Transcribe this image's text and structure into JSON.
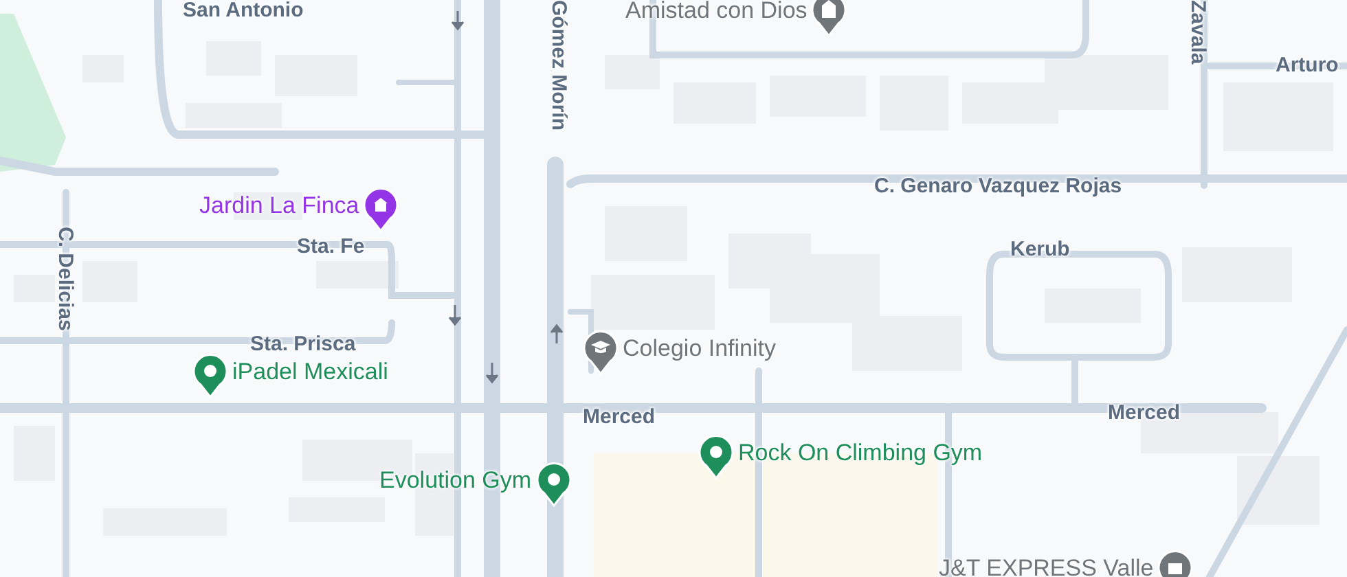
{
  "streets": [
    {
      "name": "San Antonio",
      "kind": "horizontal"
    },
    {
      "name": "Gómez Morín",
      "kind": "vertical"
    },
    {
      "name": "C. Genaro Vazquez Rojas",
      "kind": "horizontal"
    },
    {
      "name": "Sta. Fe",
      "kind": "horizontal"
    },
    {
      "name": "C. Delicias",
      "kind": "vertical"
    },
    {
      "name": "Kerub",
      "kind": "horizontal"
    },
    {
      "name": "Sta. Prisca",
      "kind": "horizontal"
    },
    {
      "name": "Merced",
      "kind": "horizontal"
    },
    {
      "name": "Merced",
      "kind": "horizontal"
    },
    {
      "name": "Zavala",
      "kind": "vertical"
    },
    {
      "name": "Arturo",
      "kind": "horizontal"
    }
  ],
  "places": [
    {
      "name": "Amistad con Dios",
      "kind": "worship",
      "color": "#70757a"
    },
    {
      "name": "Jardin La Finca",
      "kind": "garden",
      "color": "#9334e6"
    },
    {
      "name": "Colegio Infinity",
      "kind": "school",
      "color": "#70757a"
    },
    {
      "name": "iPadel Mexicali",
      "kind": "generic",
      "color": "#1e8e5a"
    },
    {
      "name": "Evolution Gym",
      "kind": "generic",
      "color": "#1e8e5a"
    },
    {
      "name": "Rock On Climbing Gym",
      "kind": "generic",
      "color": "#1e8e5a"
    },
    {
      "name": "J&T EXPRESS Valle",
      "kind": "store",
      "color": "#70757a"
    }
  ]
}
